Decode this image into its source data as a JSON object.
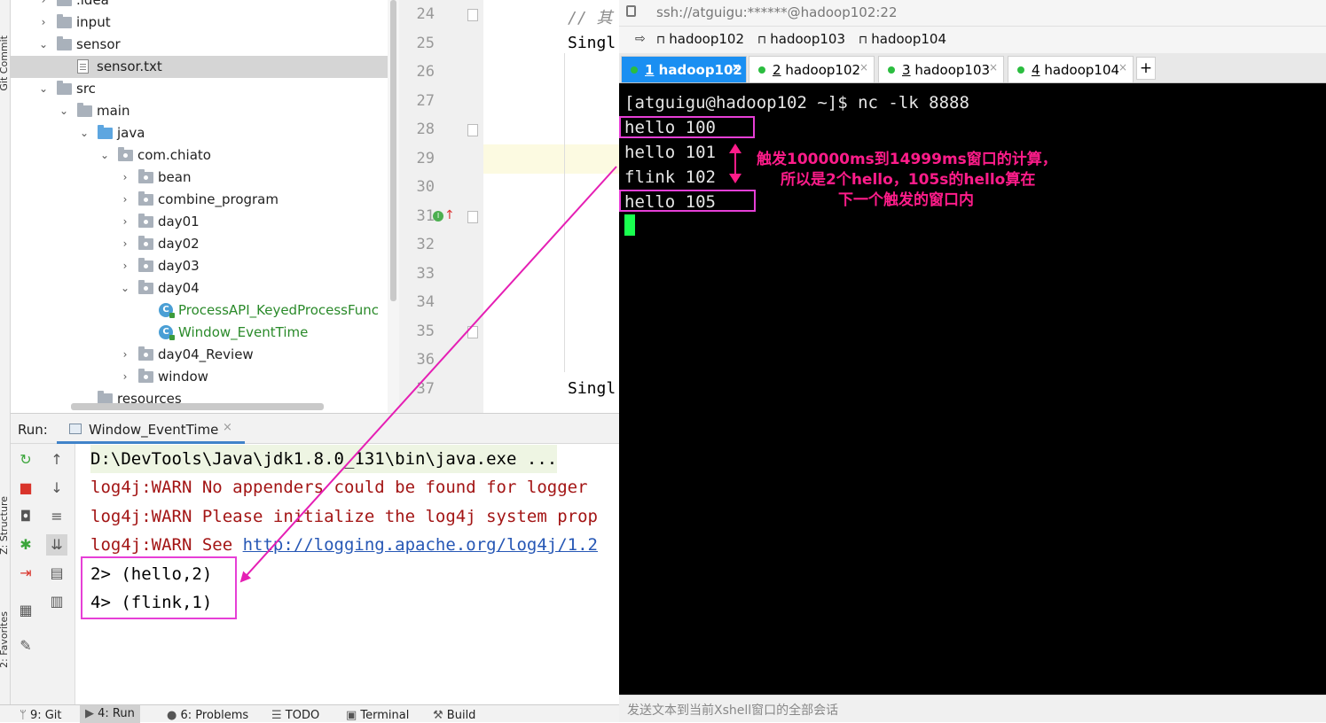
{
  "left_strip": {
    "labels": [
      "Git Commit",
      "Z: Structure",
      "2: Favorites"
    ]
  },
  "project_tree": {
    "rows": [
      {
        "label": ".idea",
        "level": 0,
        "expanded": false,
        "kind": "folder"
      },
      {
        "label": "input",
        "level": 0,
        "expanded": false,
        "kind": "folder"
      },
      {
        "label": "sensor",
        "level": 0,
        "expanded": true,
        "kind": "folder"
      },
      {
        "label": "sensor.txt",
        "level": 1,
        "kind": "file",
        "selected": true
      },
      {
        "label": "src",
        "level": 0,
        "expanded": true,
        "kind": "folder"
      },
      {
        "label": "main",
        "level": 1,
        "expanded": true,
        "kind": "folder"
      },
      {
        "label": "java",
        "level": 2,
        "expanded": true,
        "kind": "java"
      },
      {
        "label": "com.chiato",
        "level": 3,
        "expanded": true,
        "kind": "package"
      },
      {
        "label": "bean",
        "level": 4,
        "expanded": false,
        "kind": "package"
      },
      {
        "label": "combine_program",
        "level": 4,
        "expanded": false,
        "kind": "package"
      },
      {
        "label": "day01",
        "level": 4,
        "expanded": false,
        "kind": "package"
      },
      {
        "label": "day02",
        "level": 4,
        "expanded": false,
        "kind": "package"
      },
      {
        "label": "day03",
        "level": 4,
        "expanded": false,
        "kind": "package"
      },
      {
        "label": "day04",
        "level": 4,
        "expanded": true,
        "kind": "package"
      },
      {
        "label": "ProcessAPI_KeyedProcessFunc",
        "level": 5,
        "kind": "class"
      },
      {
        "label": "Window_EventTime",
        "level": 5,
        "kind": "class"
      },
      {
        "label": "day04_Review",
        "level": 4,
        "expanded": false,
        "kind": "package"
      },
      {
        "label": "window",
        "level": 4,
        "expanded": false,
        "kind": "package"
      },
      {
        "label": "resources",
        "level": 2,
        "kind": "folder"
      }
    ]
  },
  "editor": {
    "line_numbers": [
      "24",
      "25",
      "26",
      "27",
      "28",
      "29",
      "30",
      "31",
      "32",
      "33",
      "34",
      "35",
      "36",
      "37"
    ],
    "code": {
      "line24": "// 其",
      "line25": "Singl",
      "line37": "Singl"
    }
  },
  "run_panel": {
    "label": "Run:",
    "tab": "Window_EventTime",
    "console": [
      {
        "text": "D:\\DevTools\\Java\\jdk1.8.0_131\\bin\\java.exe ...",
        "style": "cmd"
      },
      {
        "text": "log4j:WARN No appenders could be found for logger",
        "style": "warn"
      },
      {
        "text": "log4j:WARN Please initialize the log4j system prop",
        "style": "warn"
      },
      {
        "text_prefix": "log4j:WARN See ",
        "link": "http://logging.apache.org/log4j/1.2",
        "style": "warn"
      },
      {
        "text": "2> (hello,2)",
        "style": "out"
      },
      {
        "text": "4> (flink,1)",
        "style": "out"
      }
    ]
  },
  "bottom_bar": {
    "items": [
      "9: Git",
      "4: Run",
      "6: Problems",
      "TODO",
      "Terminal",
      "Build"
    ],
    "active": "4: Run"
  },
  "xshell": {
    "address": "ssh://atguigu:******@hadoop102:22",
    "bookmarks": [
      "hadoop102",
      "hadoop103",
      "hadoop104"
    ],
    "tabs": [
      {
        "num": "1",
        "label": "hadoop102",
        "active": true
      },
      {
        "num": "2",
        "label": "hadoop102",
        "active": false
      },
      {
        "num": "3",
        "label": "hadoop103",
        "active": false
      },
      {
        "num": "4",
        "label": "hadoop104",
        "active": false
      }
    ],
    "add_tab": "+",
    "terminal": {
      "prompt": "[atguigu@hadoop102 ~]$ nc -lk 8888",
      "lines": [
        "hello 100",
        "hello 101",
        "flink 102",
        "hello 105"
      ]
    },
    "annotation": {
      "line1": "触发100000ms到14999ms窗口的计算，",
      "line2": "所以是2个hello，105s的hello算在",
      "line3": "下一个触发的窗口内"
    },
    "status_text": "发送文本到当前Xshell窗口的全部会话"
  },
  "colors": {
    "annotation": "#ff1c8a",
    "box": "#e63fd6",
    "cursor": "#19ff4f",
    "active_tab": "#1a8ff2"
  }
}
